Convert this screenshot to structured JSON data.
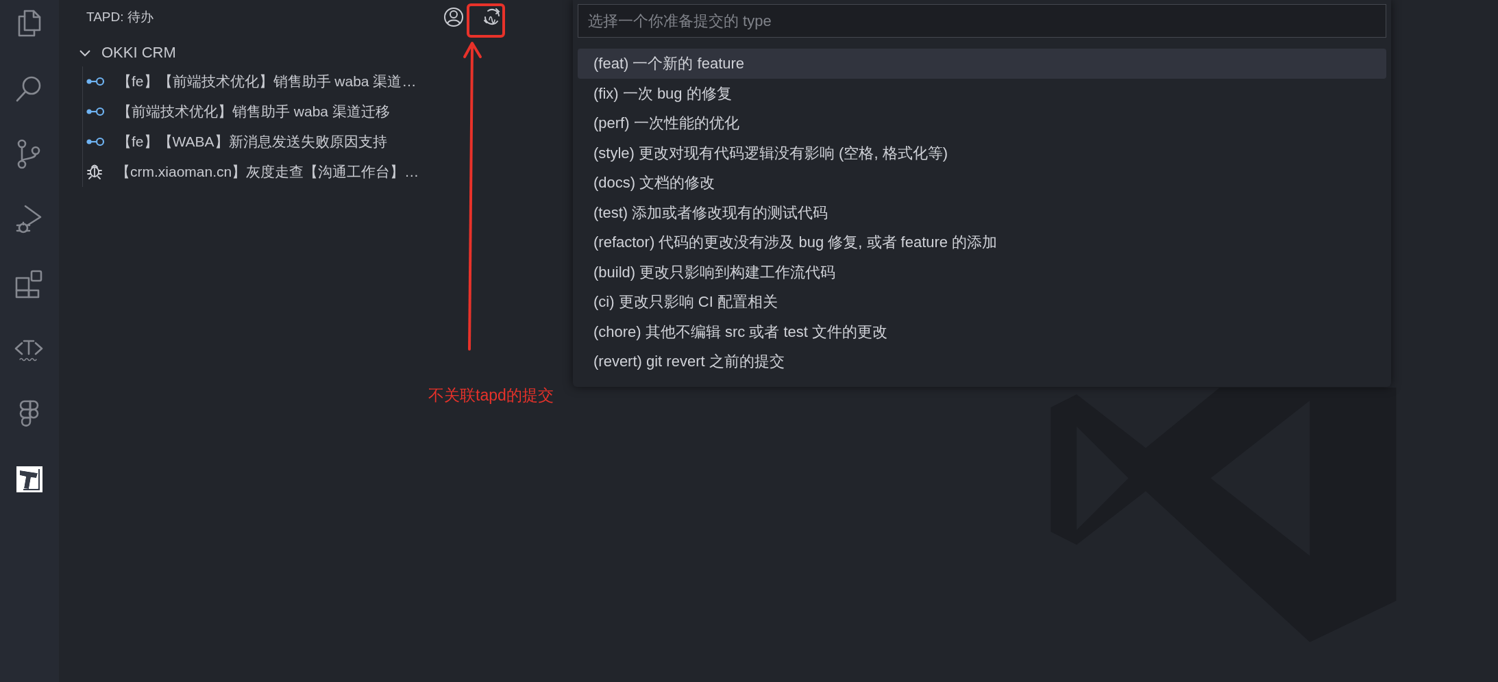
{
  "activity_bar": {
    "items": [
      {
        "kind": "files",
        "selected": false
      },
      {
        "kind": "search",
        "selected": false
      },
      {
        "kind": "source-control",
        "selected": false
      },
      {
        "kind": "run-debug",
        "selected": false
      },
      {
        "kind": "extensions",
        "selected": false
      },
      {
        "kind": "text-tag",
        "selected": false
      },
      {
        "kind": "figma",
        "selected": false
      },
      {
        "kind": "tapd",
        "selected": true
      }
    ]
  },
  "sidebar": {
    "title": "TAPD: 待办",
    "actions": [
      {
        "kind": "account"
      },
      {
        "kind": "commit"
      }
    ],
    "tree": {
      "label": "OKKI CRM",
      "expanded": true,
      "children": [
        {
          "kind": "story",
          "label": "【fe】【前端技术优化】销售助手 waba 渠道…"
        },
        {
          "kind": "story",
          "label": "【前端技术优化】销售助手 waba 渠道迁移"
        },
        {
          "kind": "story",
          "label": "【fe】【WABA】新消息发送失败原因支持"
        },
        {
          "kind": "bug",
          "label": "【crm.xiaoman.cn】灰度走查【沟通工作台】…"
        }
      ]
    }
  },
  "quick_pick": {
    "placeholder": "选择一个你准备提交的 type",
    "items": [
      {
        "label": "(feat) 一个新的 feature",
        "selected": true
      },
      {
        "label": "(fix) 一次 bug 的修复",
        "selected": false
      },
      {
        "label": "(perf) 一次性能的优化",
        "selected": false
      },
      {
        "label": "(style) 更改对现有代码逻辑没有影响 (空格, 格式化等)",
        "selected": false
      },
      {
        "label": "(docs) 文档的修改",
        "selected": false
      },
      {
        "label": "(test) 添加或者修改现有的测试代码",
        "selected": false
      },
      {
        "label": "(refactor) 代码的更改没有涉及 bug 修复, 或者 feature 的添加",
        "selected": false
      },
      {
        "label": "(build) 更改只影响到构建工作流代码",
        "selected": false
      },
      {
        "label": "(ci) 更改只影响 CI 配置相关",
        "selected": false
      },
      {
        "label": "(chore) 其他不编辑 src 或者 test 文件的更改",
        "selected": false
      },
      {
        "label": "(revert) git revert 之前的提交",
        "selected": false
      }
    ]
  },
  "annotation": {
    "text": "不关联tapd的提交"
  }
}
